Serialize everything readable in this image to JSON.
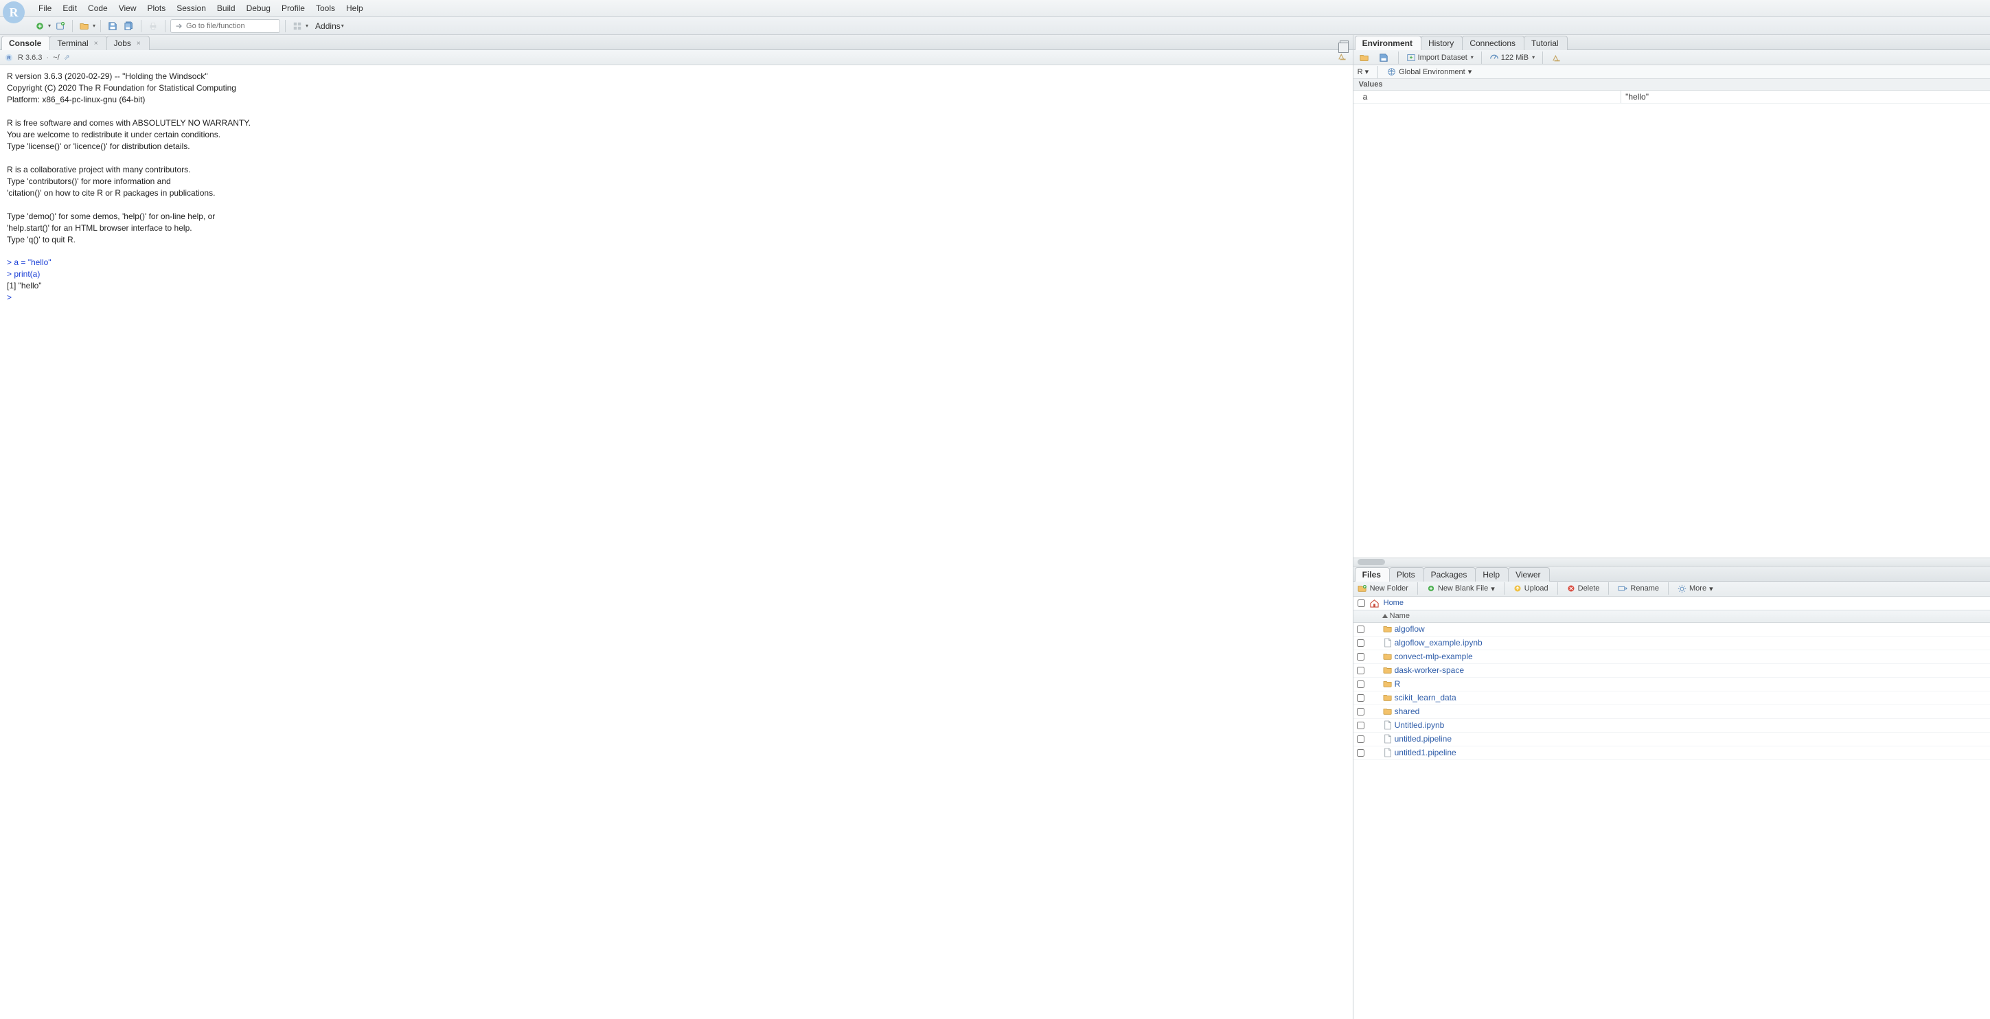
{
  "menu": [
    "File",
    "Edit",
    "Code",
    "View",
    "Plots",
    "Session",
    "Build",
    "Debug",
    "Profile",
    "Tools",
    "Help"
  ],
  "toolbar": {
    "goto_placeholder": "Go to file/function",
    "addins_label": "Addins"
  },
  "left_tabs": [
    {
      "label": "Console",
      "closable": false
    },
    {
      "label": "Terminal",
      "closable": true
    },
    {
      "label": "Jobs",
      "closable": true
    }
  ],
  "left_tabs_active": 0,
  "console_sub": {
    "version": "R 3.6.3",
    "wd": "~/"
  },
  "console_text": {
    "banner": "R version 3.6.3 (2020-02-29) -- \"Holding the Windsock\"\nCopyright (C) 2020 The R Foundation for Statistical Computing\nPlatform: x86_64-pc-linux-gnu (64-bit)\n\nR is free software and comes with ABSOLUTELY NO WARRANTY.\nYou are welcome to redistribute it under certain conditions.\nType 'license()' or 'licence()' for distribution details.\n\nR is a collaborative project with many contributors.\nType 'contributors()' for more information and\n'citation()' on how to cite R or R packages in publications.\n\nType 'demo()' for some demos, 'help()' for on-line help, or\n'help.start()' for an HTML browser interface to help.\nType 'q()' to quit R.\n",
    "cmd1": "> a = \"hello\"",
    "cmd2": "> print(a)",
    "out1": "[1] \"hello\"",
    "prompt": "> "
  },
  "right_top_tabs": [
    "Environment",
    "History",
    "Connections",
    "Tutorial"
  ],
  "right_top_active": 0,
  "env_toolbar": {
    "import_label": "Import Dataset",
    "mem_label": "122 MiB",
    "scope_label": "R",
    "globalenv_label": "Global Environment"
  },
  "env_heading": "Values",
  "env_rows": [
    {
      "name": "a",
      "value": "\"hello\""
    }
  ],
  "right_bot_tabs": [
    "Files",
    "Plots",
    "Packages",
    "Help",
    "Viewer"
  ],
  "right_bot_active": 0,
  "files_toolbar": {
    "new_folder": "New Folder",
    "new_blank": "New Blank File",
    "upload": "Upload",
    "delete": "Delete",
    "rename": "Rename",
    "more": "More"
  },
  "breadcrumb": {
    "home": "Home"
  },
  "file_header": {
    "name_col": "Name"
  },
  "files": [
    {
      "name": "algoflow",
      "type": "folder"
    },
    {
      "name": "algoflow_example.ipynb",
      "type": "file"
    },
    {
      "name": "convect-mlp-example",
      "type": "folder"
    },
    {
      "name": "dask-worker-space",
      "type": "folder"
    },
    {
      "name": "R",
      "type": "folder"
    },
    {
      "name": "scikit_learn_data",
      "type": "folder"
    },
    {
      "name": "shared",
      "type": "folder"
    },
    {
      "name": "Untitled.ipynb",
      "type": "file"
    },
    {
      "name": "untitled.pipeline",
      "type": "file"
    },
    {
      "name": "untitled1.pipeline",
      "type": "file"
    }
  ]
}
